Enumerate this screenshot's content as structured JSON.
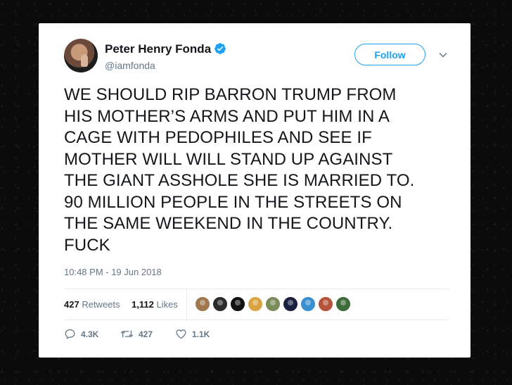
{
  "tweet": {
    "author": {
      "display_name": "Peter Henry Fonda",
      "handle": "@iamfonda",
      "verified": true
    },
    "follow_label": "Follow",
    "text": "WE SHOULD RIP BARRON TRUMP FROM\nHIS MOTHER’S ARMS AND PUT HIM IN A\nCAGE WITH PEDOPHILES AND SEE IF\nMOTHER WILL WILL STAND UP AGAINST\nTHE GIANT ASSHOLE SHE IS MARRIED TO.\n90 MILLION PEOPLE IN THE STREETS ON\nTHE SAME WEEKEND IN THE COUNTRY.\nFUCK",
    "timestamp": "10:48 PM - 19 Jun 2018",
    "stats": {
      "retweets_count": "427",
      "retweets_label": "Retweets",
      "likes_count": "1,112",
      "likes_label": "Likes"
    },
    "liker_avatars": [
      {
        "name": "liker-1",
        "color": "#a07850"
      },
      {
        "name": "liker-2",
        "color": "#2b2b2b"
      },
      {
        "name": "liker-3",
        "color": "#111111"
      },
      {
        "name": "liker-4",
        "color": "#d9a441"
      },
      {
        "name": "liker-5",
        "color": "#7a8c5a"
      },
      {
        "name": "liker-6",
        "color": "#1a2140"
      },
      {
        "name": "liker-7",
        "color": "#3a8fd0"
      },
      {
        "name": "liker-8",
        "color": "#b5523a"
      },
      {
        "name": "liker-9",
        "color": "#3d6b3a"
      }
    ],
    "actions": {
      "reply_count": "4.3K",
      "retweet_count": "427",
      "like_count": "1.1K"
    }
  },
  "colors": {
    "accent": "#1da1f2",
    "text_primary": "#14171a",
    "text_secondary": "#657786",
    "divider": "#e6ecf0",
    "background": "#0b0b0b"
  }
}
